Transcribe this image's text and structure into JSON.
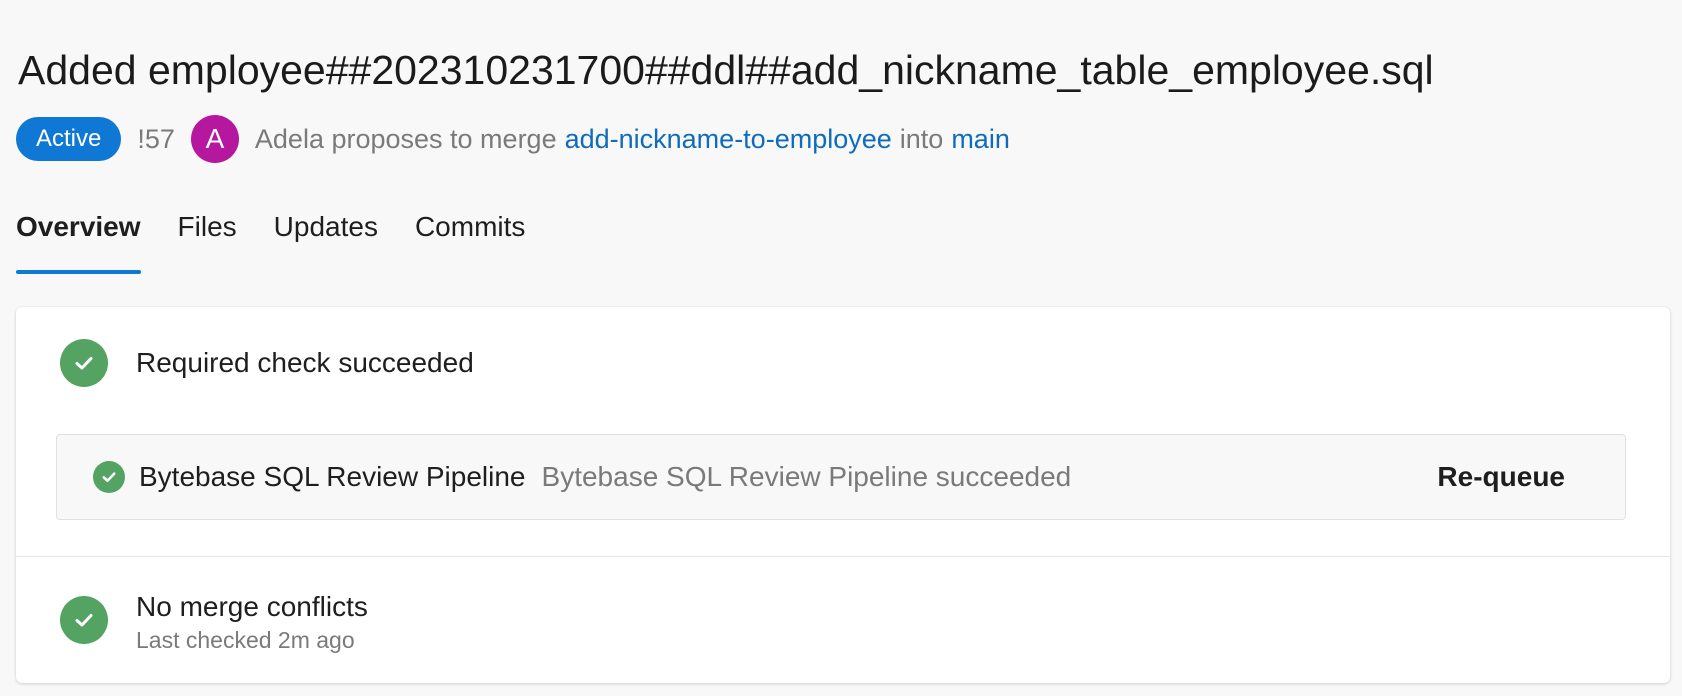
{
  "title": "Added employee##202310231700##ddl##add_nickname_table_employee.sql",
  "meta": {
    "status_badge": "Active",
    "pr_id": "!57",
    "avatar_initial": "A",
    "proposer_text": "Adela proposes to merge",
    "source_branch": "add-nickname-to-employee",
    "into_text": "into",
    "target_branch": "main"
  },
  "tabs": [
    {
      "label": "Overview",
      "active": true
    },
    {
      "label": "Files",
      "active": false
    },
    {
      "label": "Updates",
      "active": false
    },
    {
      "label": "Commits",
      "active": false
    }
  ],
  "checks": {
    "required_title": "Required check succeeded",
    "pipeline": {
      "name": "Bytebase SQL Review Pipeline",
      "status": "Bytebase SQL Review Pipeline succeeded",
      "action": "Re-queue"
    },
    "merge": {
      "title": "No merge conflicts",
      "subtitle": "Last checked 2m ago"
    }
  },
  "colors": {
    "accent": "#0f78d4",
    "link": "#0f6cbd",
    "success": "#55a362",
    "avatar": "#b5179e"
  },
  "icons": {
    "check": "checkmark-circle-icon"
  }
}
